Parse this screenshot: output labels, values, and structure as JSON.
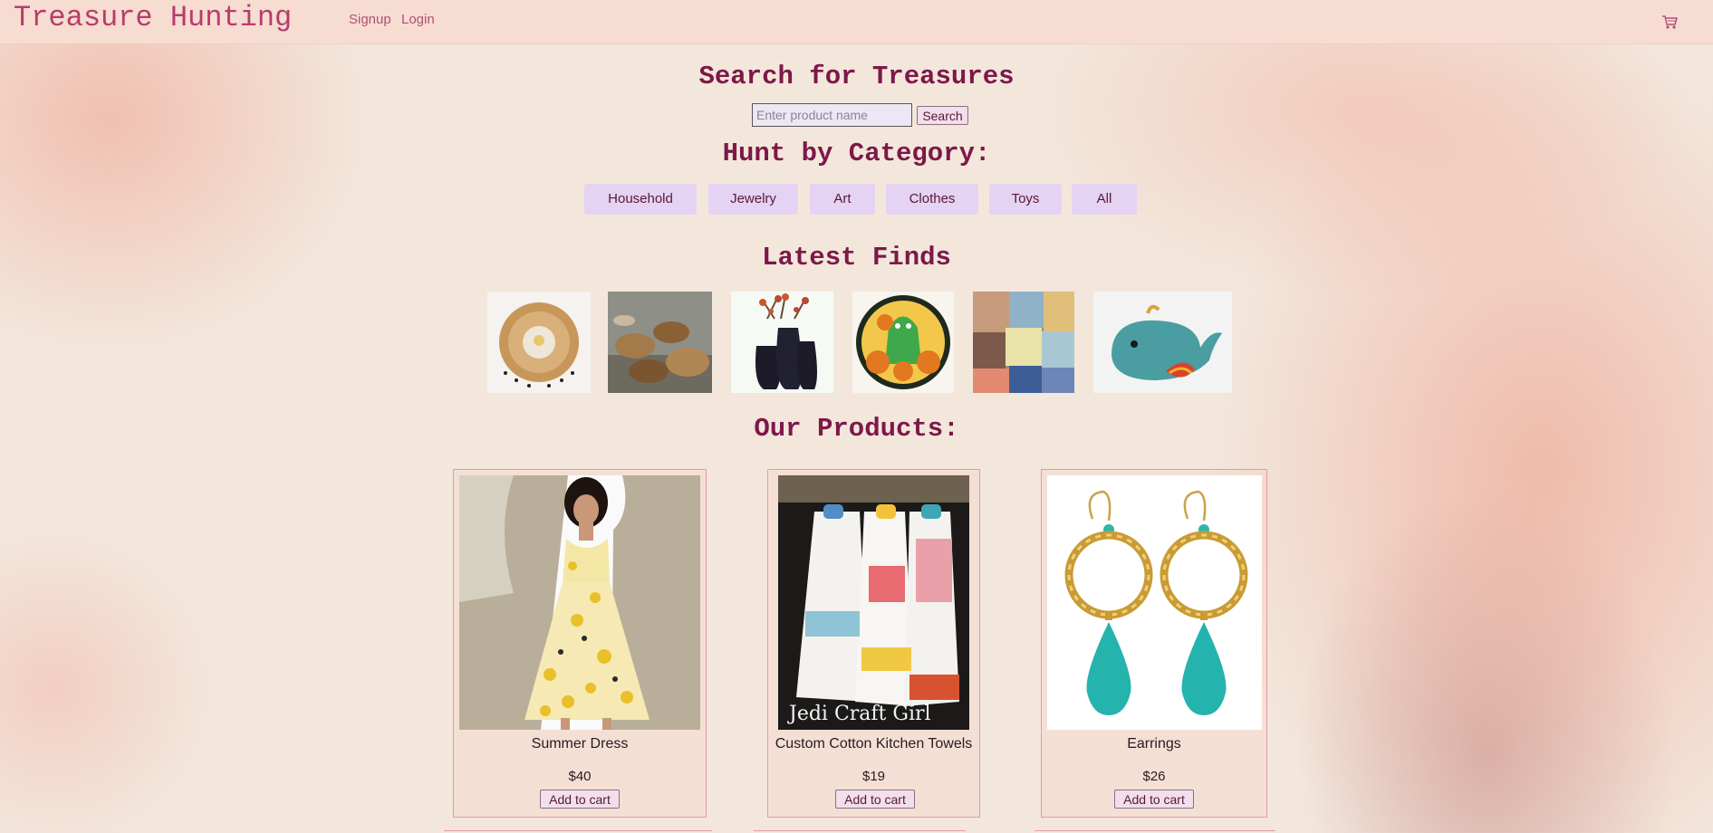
{
  "nav": {
    "brand": "Treasure Hunting",
    "links": [
      "Signup",
      "Login"
    ],
    "cart_icon": "cart-icon"
  },
  "search": {
    "heading": "Search for Treasures",
    "placeholder": "Enter product name",
    "value": "",
    "button_label": "Search"
  },
  "categories": {
    "heading": "Hunt by Category:",
    "items": [
      "Household",
      "Jewelry",
      "Art",
      "Clothes",
      "Toys",
      "All"
    ]
  },
  "latest": {
    "heading": "Latest Finds",
    "items": [
      "grass-wall-hanging",
      "woven-baskets",
      "black-vases-with-flowers",
      "halloween-cookie",
      "handmade-soaps",
      "fabric-whale-toy"
    ]
  },
  "products": {
    "heading": "Our Products:",
    "items": [
      {
        "name": "Summer Dress",
        "price": "$40",
        "button_label": "Add to cart",
        "image_caption": ""
      },
      {
        "name": "Custom Cotton Kitchen Towels",
        "price": "$19",
        "button_label": "Add to cart",
        "image_caption": "Jedi Craft Girl"
      },
      {
        "name": "Earrings",
        "price": "$26",
        "button_label": "Add to cart",
        "image_caption": ""
      }
    ]
  },
  "colors": {
    "accent": "#7d1848",
    "brand": "#b83c6a",
    "navbar": "#f7dcd1",
    "category_button": "#e4d3f2"
  }
}
